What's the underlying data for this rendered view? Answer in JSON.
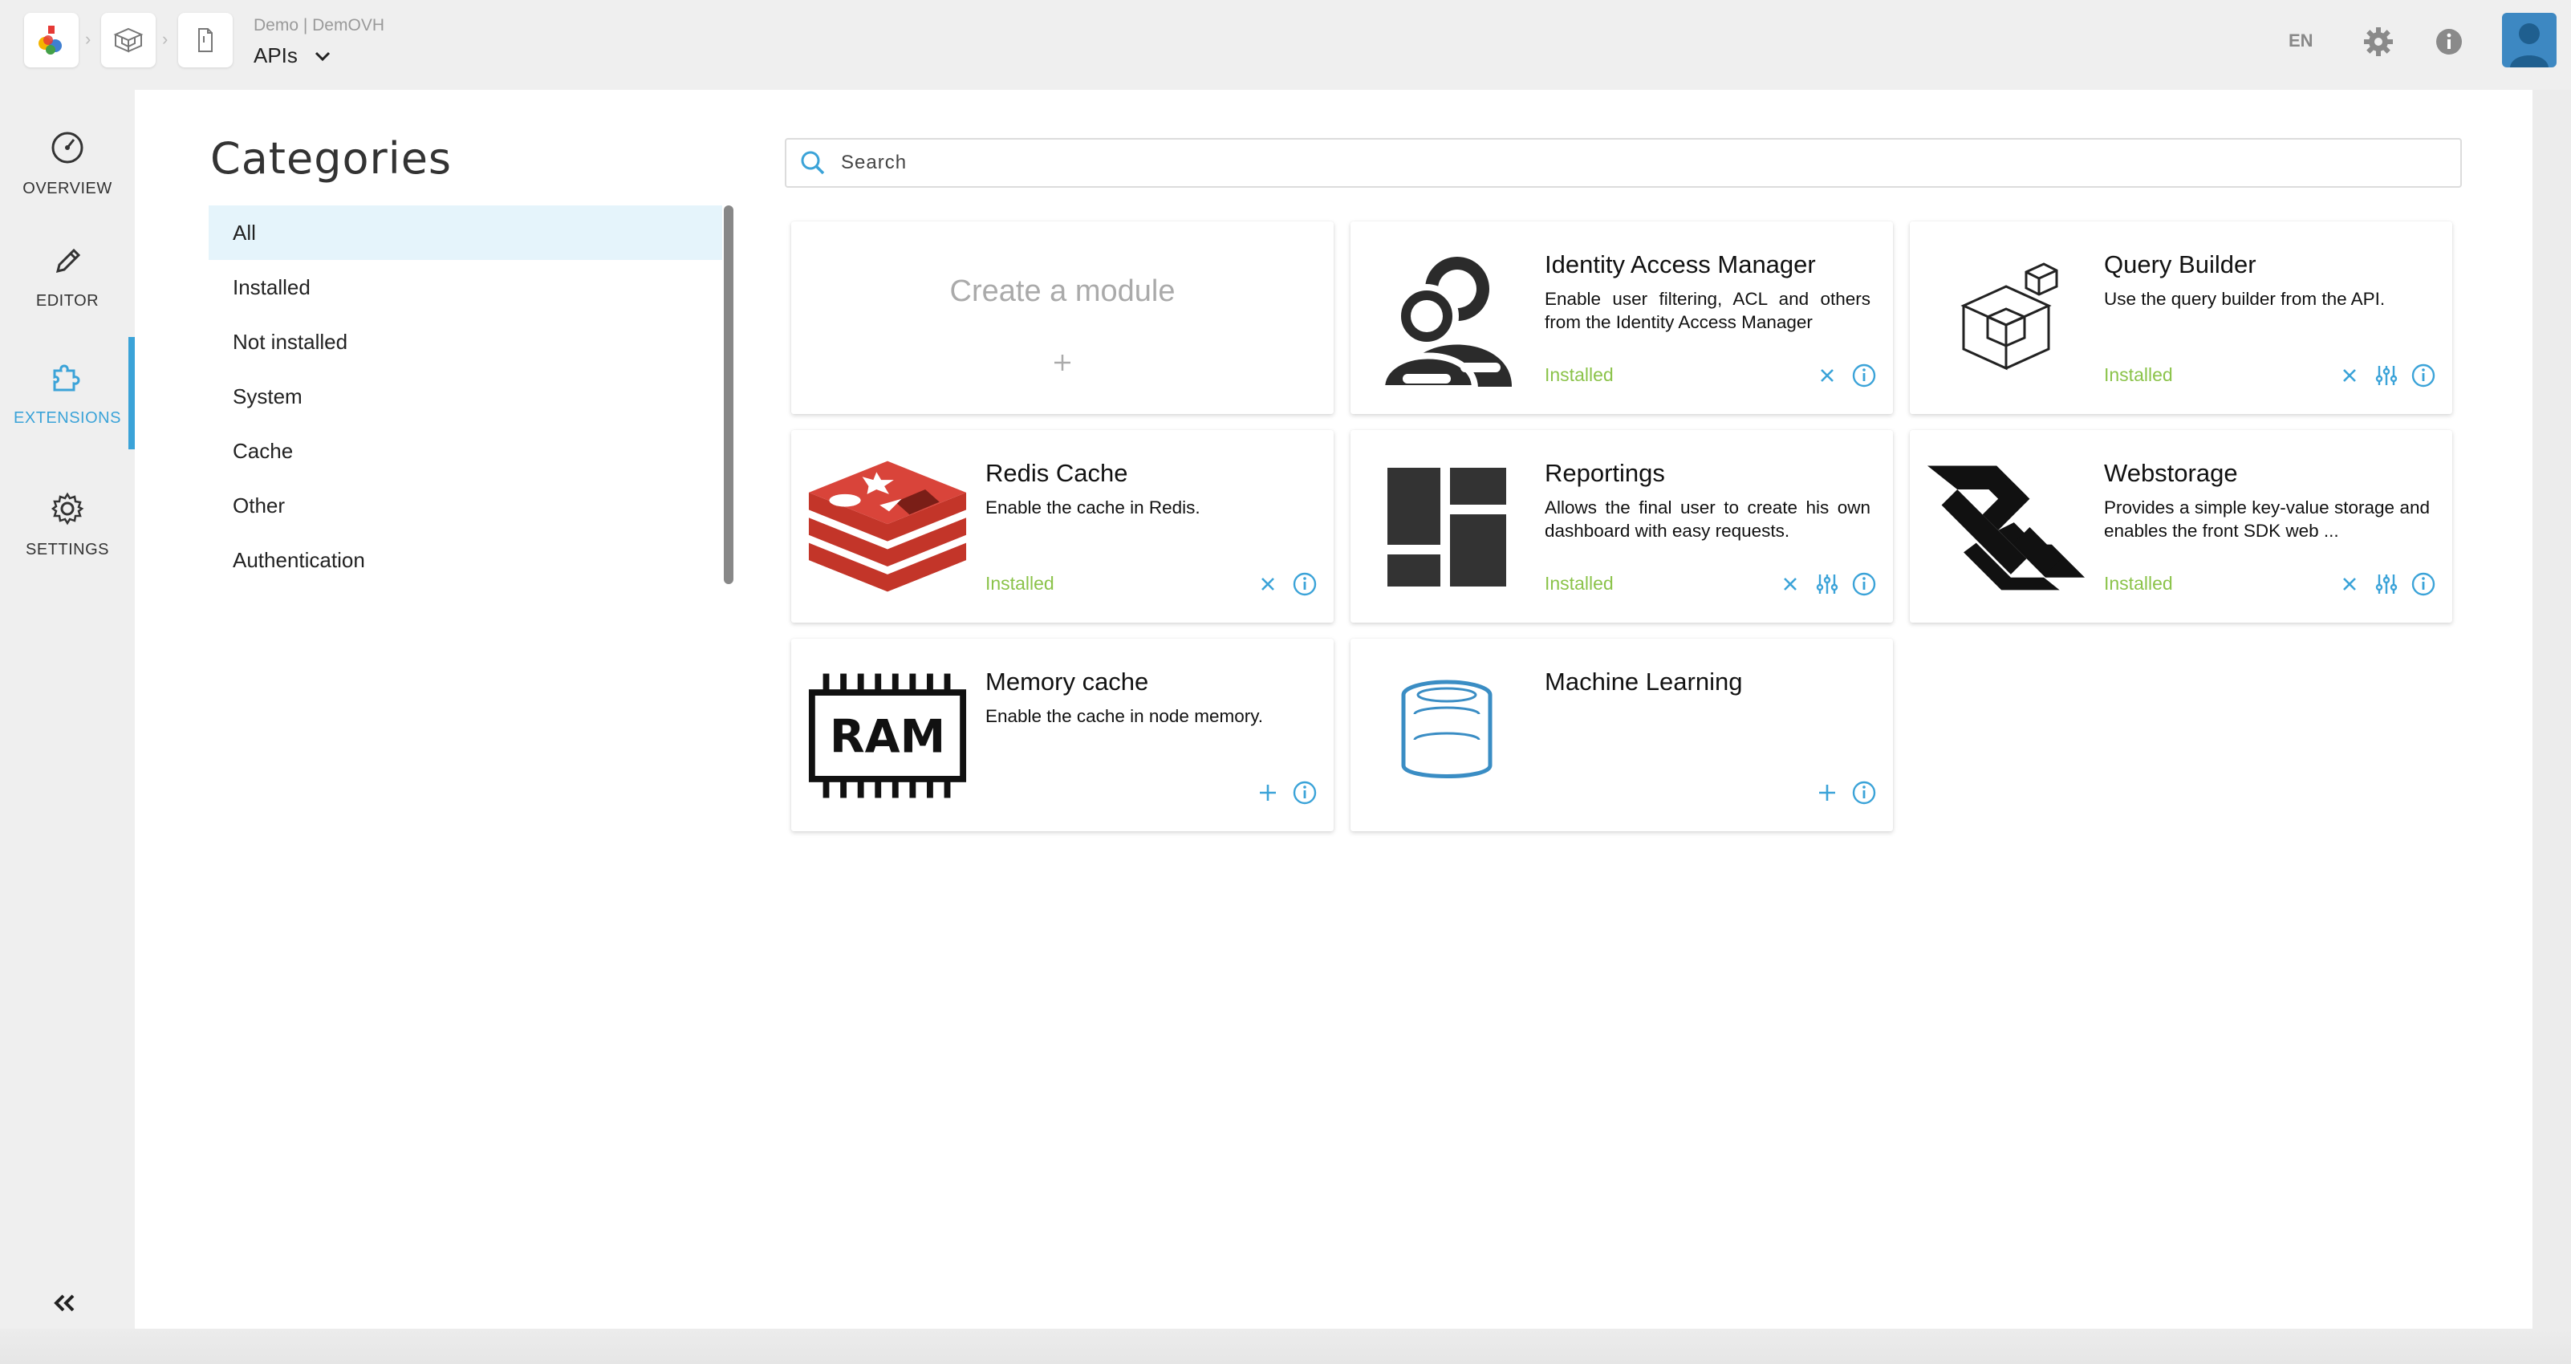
{
  "topbar": {
    "project_subtitle": "Demo | DemOVH",
    "project_title": "APIs",
    "language": "EN"
  },
  "nav": {
    "items": [
      {
        "label": "OVERVIEW",
        "icon": "gauge-icon"
      },
      {
        "label": "EDITOR",
        "icon": "pencil-icon"
      },
      {
        "label": "EXTENSIONS",
        "icon": "puzzle-icon",
        "active": true
      },
      {
        "label": "SETTINGS",
        "icon": "gear-icon"
      }
    ]
  },
  "categories": {
    "title": "Categories",
    "items": [
      "All",
      "Installed",
      "Not installed",
      "System",
      "Cache",
      "Other",
      "Authentication"
    ],
    "selected": "All"
  },
  "search": {
    "placeholder": "Search"
  },
  "create_card": {
    "title": "Create a module"
  },
  "modules": [
    {
      "title": "Identity Access Manager",
      "description": "Enable user filtering, ACL and others from the Identity Access Manager",
      "status": "Installed",
      "icon": "users-icon",
      "actions": [
        "remove",
        "info"
      ]
    },
    {
      "title": "Query Builder",
      "description": "Use the query builder from the API.",
      "status": "Installed",
      "icon": "cubes-icon",
      "actions": [
        "remove",
        "settings",
        "info"
      ]
    },
    {
      "title": "Redis Cache",
      "description": "Enable the cache in Redis.",
      "status": "Installed",
      "icon": "redis-logo-icon",
      "actions": [
        "remove",
        "info"
      ]
    },
    {
      "title": "Reportings",
      "description": "Allows the final user to create his own dashboard with easy requests.",
      "status": "Installed",
      "icon": "dashboard-blocks-icon",
      "actions": [
        "remove",
        "settings",
        "info"
      ]
    },
    {
      "title": "Webstorage",
      "description": "Provides a simple key-value storage and enables the front SDK web ...",
      "status": "Installed",
      "icon": "webstorage-logo-icon",
      "actions": [
        "remove",
        "settings",
        "info"
      ]
    },
    {
      "title": "Memory cache",
      "description": "Enable the cache in node memory.",
      "status": "",
      "icon": "ram-chip-icon",
      "actions": [
        "add",
        "info"
      ]
    },
    {
      "title": "Machine Learning",
      "description": "",
      "status": "",
      "icon": "database-icon",
      "actions": [
        "add",
        "info"
      ]
    }
  ],
  "colors": {
    "accent": "#3ba3d8",
    "installed": "#8bc34a",
    "active_bg": "#e5f4fb"
  }
}
